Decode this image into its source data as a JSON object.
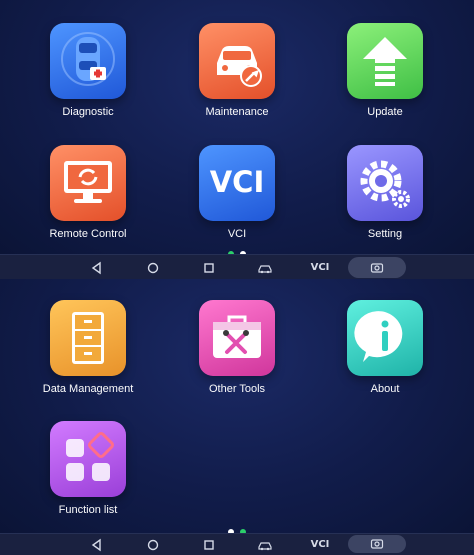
{
  "screen_top": {
    "tiles": [
      {
        "label": "Diagnostic",
        "icon": "car-diagnostic-icon"
      },
      {
        "label": "Maintenance",
        "icon": "car-wrench-icon"
      },
      {
        "label": "Update",
        "icon": "up-arrow-icon"
      },
      {
        "label": "Remote Control",
        "icon": "remote-monitor-icon"
      },
      {
        "label": "VCI",
        "icon": "vci-icon"
      },
      {
        "label": "Setting",
        "icon": "gear-icon"
      }
    ],
    "vci_text": "VCI",
    "page_indicator": {
      "active_index": 0,
      "count": 2
    }
  },
  "screen_bottom": {
    "tiles": [
      {
        "label": "Data Management",
        "icon": "file-cabinet-icon"
      },
      {
        "label": "Other Tools",
        "icon": "toolbox-icon"
      },
      {
        "label": "About",
        "icon": "info-icon"
      },
      {
        "label": "Function list",
        "icon": "apps-grid-icon"
      }
    ],
    "page_indicator": {
      "active_index": 1,
      "count": 2
    }
  },
  "navbar": {
    "buttons": [
      "back-icon",
      "home-icon",
      "recents-icon",
      "car-shortcut-icon",
      "vci-shortcut-icon",
      "screenshot-icon"
    ],
    "vci_label": "VCI"
  },
  "colors": {
    "background": "#111c4a",
    "diagnostic": "#2f73e8",
    "maintenance": "#f0683f",
    "update": "#5fd65a",
    "remote_control": "#f0683f",
    "vci": "#2f73e8",
    "setting": "#6f6be8",
    "data_management": "#f2a93a",
    "other_tools": "#e24fb0",
    "about": "#2fcfc0",
    "function_list": "#b35ae6",
    "indicator_active": "#2ccf6a"
  }
}
